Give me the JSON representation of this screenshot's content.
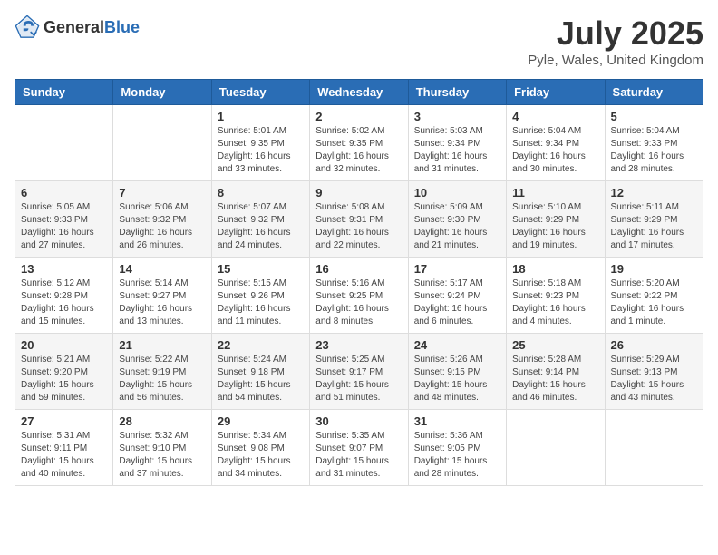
{
  "header": {
    "logo_general": "General",
    "logo_blue": "Blue",
    "month": "July 2025",
    "location": "Pyle, Wales, United Kingdom"
  },
  "days_of_week": [
    "Sunday",
    "Monday",
    "Tuesday",
    "Wednesday",
    "Thursday",
    "Friday",
    "Saturday"
  ],
  "weeks": [
    [
      {
        "day": "",
        "detail": ""
      },
      {
        "day": "",
        "detail": ""
      },
      {
        "day": "1",
        "detail": "Sunrise: 5:01 AM\nSunset: 9:35 PM\nDaylight: 16 hours\nand 33 minutes."
      },
      {
        "day": "2",
        "detail": "Sunrise: 5:02 AM\nSunset: 9:35 PM\nDaylight: 16 hours\nand 32 minutes."
      },
      {
        "day": "3",
        "detail": "Sunrise: 5:03 AM\nSunset: 9:34 PM\nDaylight: 16 hours\nand 31 minutes."
      },
      {
        "day": "4",
        "detail": "Sunrise: 5:04 AM\nSunset: 9:34 PM\nDaylight: 16 hours\nand 30 minutes."
      },
      {
        "day": "5",
        "detail": "Sunrise: 5:04 AM\nSunset: 9:33 PM\nDaylight: 16 hours\nand 28 minutes."
      }
    ],
    [
      {
        "day": "6",
        "detail": "Sunrise: 5:05 AM\nSunset: 9:33 PM\nDaylight: 16 hours\nand 27 minutes."
      },
      {
        "day": "7",
        "detail": "Sunrise: 5:06 AM\nSunset: 9:32 PM\nDaylight: 16 hours\nand 26 minutes."
      },
      {
        "day": "8",
        "detail": "Sunrise: 5:07 AM\nSunset: 9:32 PM\nDaylight: 16 hours\nand 24 minutes."
      },
      {
        "day": "9",
        "detail": "Sunrise: 5:08 AM\nSunset: 9:31 PM\nDaylight: 16 hours\nand 22 minutes."
      },
      {
        "day": "10",
        "detail": "Sunrise: 5:09 AM\nSunset: 9:30 PM\nDaylight: 16 hours\nand 21 minutes."
      },
      {
        "day": "11",
        "detail": "Sunrise: 5:10 AM\nSunset: 9:29 PM\nDaylight: 16 hours\nand 19 minutes."
      },
      {
        "day": "12",
        "detail": "Sunrise: 5:11 AM\nSunset: 9:29 PM\nDaylight: 16 hours\nand 17 minutes."
      }
    ],
    [
      {
        "day": "13",
        "detail": "Sunrise: 5:12 AM\nSunset: 9:28 PM\nDaylight: 16 hours\nand 15 minutes."
      },
      {
        "day": "14",
        "detail": "Sunrise: 5:14 AM\nSunset: 9:27 PM\nDaylight: 16 hours\nand 13 minutes."
      },
      {
        "day": "15",
        "detail": "Sunrise: 5:15 AM\nSunset: 9:26 PM\nDaylight: 16 hours\nand 11 minutes."
      },
      {
        "day": "16",
        "detail": "Sunrise: 5:16 AM\nSunset: 9:25 PM\nDaylight: 16 hours\nand 8 minutes."
      },
      {
        "day": "17",
        "detail": "Sunrise: 5:17 AM\nSunset: 9:24 PM\nDaylight: 16 hours\nand 6 minutes."
      },
      {
        "day": "18",
        "detail": "Sunrise: 5:18 AM\nSunset: 9:23 PM\nDaylight: 16 hours\nand 4 minutes."
      },
      {
        "day": "19",
        "detail": "Sunrise: 5:20 AM\nSunset: 9:22 PM\nDaylight: 16 hours\nand 1 minute."
      }
    ],
    [
      {
        "day": "20",
        "detail": "Sunrise: 5:21 AM\nSunset: 9:20 PM\nDaylight: 15 hours\nand 59 minutes."
      },
      {
        "day": "21",
        "detail": "Sunrise: 5:22 AM\nSunset: 9:19 PM\nDaylight: 15 hours\nand 56 minutes."
      },
      {
        "day": "22",
        "detail": "Sunrise: 5:24 AM\nSunset: 9:18 PM\nDaylight: 15 hours\nand 54 minutes."
      },
      {
        "day": "23",
        "detail": "Sunrise: 5:25 AM\nSunset: 9:17 PM\nDaylight: 15 hours\nand 51 minutes."
      },
      {
        "day": "24",
        "detail": "Sunrise: 5:26 AM\nSunset: 9:15 PM\nDaylight: 15 hours\nand 48 minutes."
      },
      {
        "day": "25",
        "detail": "Sunrise: 5:28 AM\nSunset: 9:14 PM\nDaylight: 15 hours\nand 46 minutes."
      },
      {
        "day": "26",
        "detail": "Sunrise: 5:29 AM\nSunset: 9:13 PM\nDaylight: 15 hours\nand 43 minutes."
      }
    ],
    [
      {
        "day": "27",
        "detail": "Sunrise: 5:31 AM\nSunset: 9:11 PM\nDaylight: 15 hours\nand 40 minutes."
      },
      {
        "day": "28",
        "detail": "Sunrise: 5:32 AM\nSunset: 9:10 PM\nDaylight: 15 hours\nand 37 minutes."
      },
      {
        "day": "29",
        "detail": "Sunrise: 5:34 AM\nSunset: 9:08 PM\nDaylight: 15 hours\nand 34 minutes."
      },
      {
        "day": "30",
        "detail": "Sunrise: 5:35 AM\nSunset: 9:07 PM\nDaylight: 15 hours\nand 31 minutes."
      },
      {
        "day": "31",
        "detail": "Sunrise: 5:36 AM\nSunset: 9:05 PM\nDaylight: 15 hours\nand 28 minutes."
      },
      {
        "day": "",
        "detail": ""
      },
      {
        "day": "",
        "detail": ""
      }
    ]
  ]
}
